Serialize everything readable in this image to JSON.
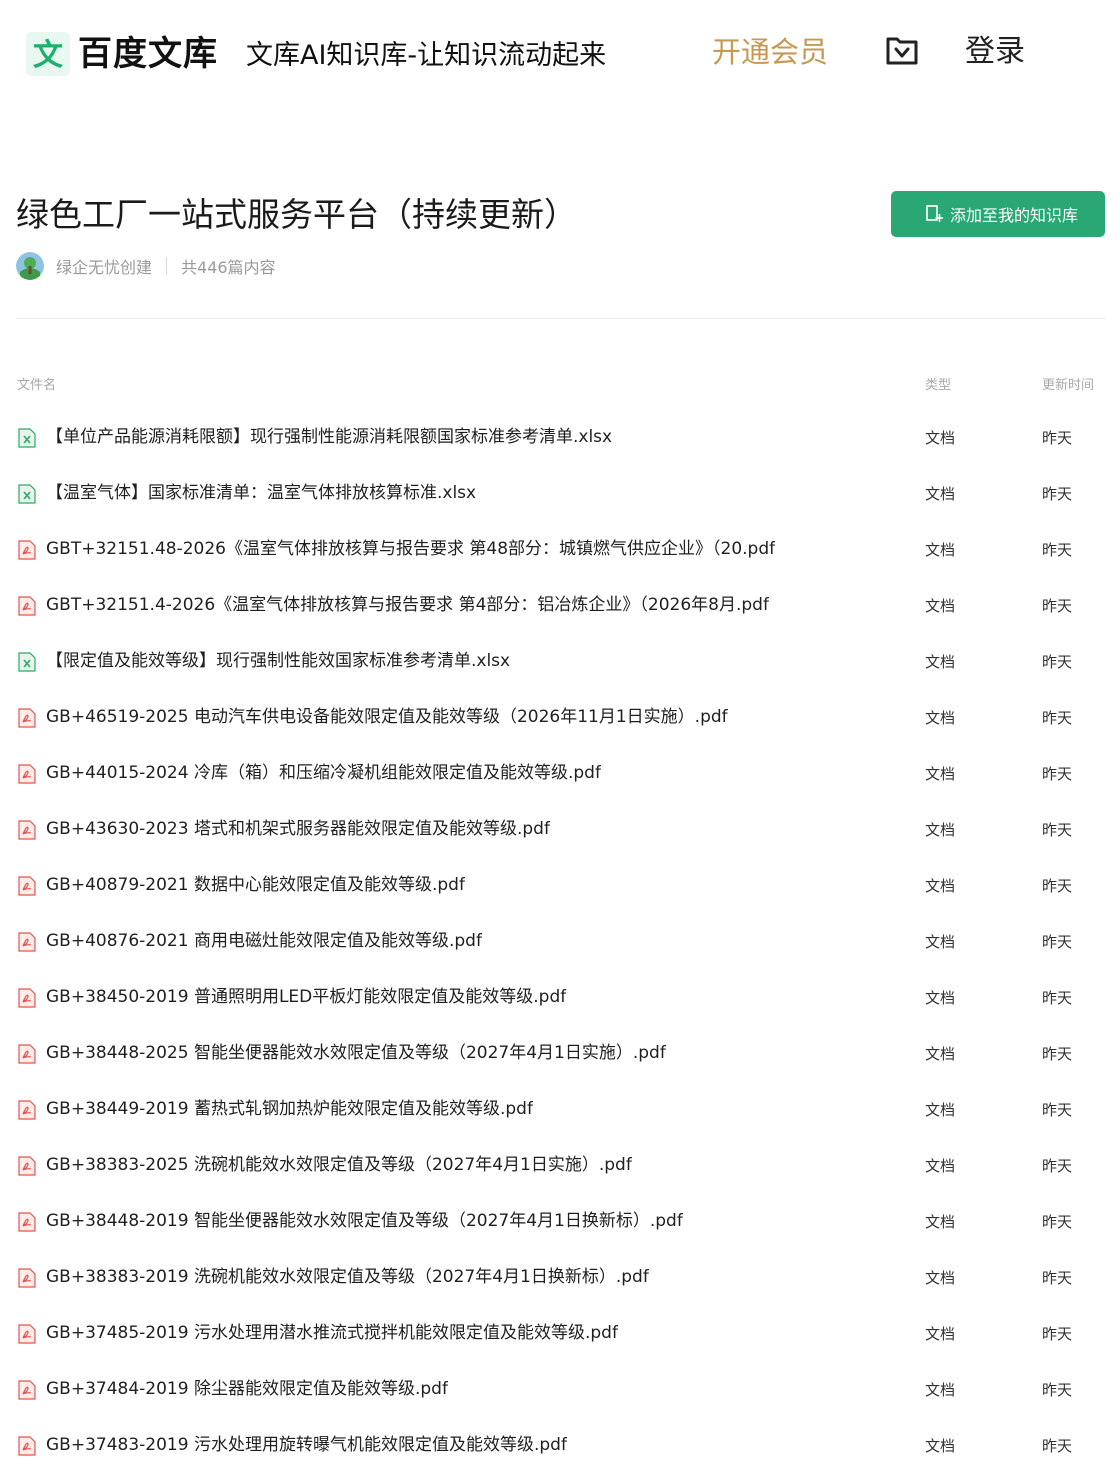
{
  "header": {
    "logo_char": "文",
    "logo_text": "百度文库",
    "slogan": "文库AI知识库-让知识流动起来",
    "vip_label": "开通会员",
    "login_label": "登录"
  },
  "collection": {
    "title": "绿色工厂一站式服务平台（持续更新）",
    "author": "绿企无忧创建",
    "count_text": "共446篇内容",
    "add_button_label": "添加至我的知识库"
  },
  "table": {
    "columns": {
      "name": "文件名",
      "type": "类型",
      "time": "更新时间"
    },
    "rows": [
      {
        "icon": "xlsx",
        "name": "【单位产品能源消耗限额】现行强制性能源消耗限额国家标准参考清单.xlsx",
        "type": "文档",
        "time": "昨天"
      },
      {
        "icon": "xlsx",
        "name": "【温室气体】国家标准清单：温室气体排放核算标准.xlsx",
        "type": "文档",
        "time": "昨天"
      },
      {
        "icon": "pdf",
        "name": "GBT+32151.48-2026《温室气体排放核算与报告要求 第48部分：城镇燃气供应企业》（20.pdf",
        "type": "文档",
        "time": "昨天"
      },
      {
        "icon": "pdf",
        "name": "GBT+32151.4-2026《温室气体排放核算与报告要求 第4部分：铝冶炼企业》（2026年8月.pdf",
        "type": "文档",
        "time": "昨天"
      },
      {
        "icon": "xlsx",
        "name": "【限定值及能效等级】现行强制性能效国家标准参考清单.xlsx",
        "type": "文档",
        "time": "昨天"
      },
      {
        "icon": "pdf",
        "name": "GB+46519-2025 电动汽车供电设备能效限定值及能效等级（2026年11月1日实施）.pdf",
        "type": "文档",
        "time": "昨天"
      },
      {
        "icon": "pdf",
        "name": "GB+44015-2024 冷库（箱）和压缩冷凝机组能效限定值及能效等级.pdf",
        "type": "文档",
        "time": "昨天"
      },
      {
        "icon": "pdf",
        "name": "GB+43630-2023 塔式和机架式服务器能效限定值及能效等级.pdf",
        "type": "文档",
        "time": "昨天"
      },
      {
        "icon": "pdf",
        "name": "GB+40879-2021 数据中心能效限定值及能效等级.pdf",
        "type": "文档",
        "time": "昨天"
      },
      {
        "icon": "pdf",
        "name": "GB+40876-2021 商用电磁灶能效限定值及能效等级.pdf",
        "type": "文档",
        "time": "昨天"
      },
      {
        "icon": "pdf",
        "name": "GB+38450-2019 普通照明用LED平板灯能效限定值及能效等级.pdf",
        "type": "文档",
        "time": "昨天"
      },
      {
        "icon": "pdf",
        "name": "GB+38448-2025 智能坐便器能效水效限定值及等级（2027年4月1日实施）.pdf",
        "type": "文档",
        "time": "昨天"
      },
      {
        "icon": "pdf",
        "name": "GB+38449-2019 蓄热式轧钢加热炉能效限定值及能效等级.pdf",
        "type": "文档",
        "time": "昨天"
      },
      {
        "icon": "pdf",
        "name": "GB+38383-2025 洗碗机能效水效限定值及等级（2027年4月1日实施）.pdf",
        "type": "文档",
        "time": "昨天"
      },
      {
        "icon": "pdf",
        "name": "GB+38448-2019 智能坐便器能效水效限定值及等级（2027年4月1日换新标）.pdf",
        "type": "文档",
        "time": "昨天"
      },
      {
        "icon": "pdf",
        "name": "GB+38383-2019 洗碗机能效水效限定值及等级（2027年4月1日换新标）.pdf",
        "type": "文档",
        "time": "昨天"
      },
      {
        "icon": "pdf",
        "name": "GB+37485-2019 污水处理用潜水推流式搅拌机能效限定值及能效等级.pdf",
        "type": "文档",
        "time": "昨天"
      },
      {
        "icon": "pdf",
        "name": "GB+37484-2019 除尘器能效限定值及能效等级.pdf",
        "type": "文档",
        "time": "昨天"
      },
      {
        "icon": "pdf",
        "name": "GB+37483-2019 污水处理用旋转曝气机能效限定值及能效等级.pdf",
        "type": "文档",
        "time": "昨天"
      }
    ]
  },
  "colors": {
    "brand_green": "#2aa873",
    "vip_gold": "#c69a53",
    "pdf_red": "#e2554a",
    "xlsx_green": "#2fa866"
  }
}
